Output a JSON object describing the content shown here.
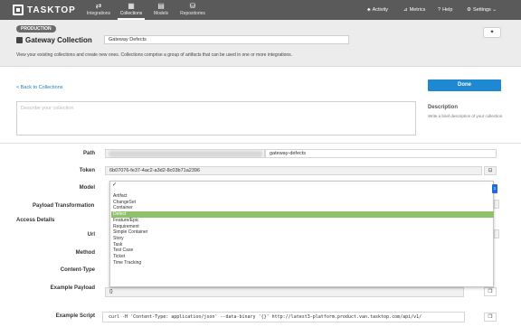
{
  "nav": {
    "logo": "TASKTOP",
    "items": [
      {
        "label": "Integrations",
        "icon": "⇄"
      },
      {
        "label": "Collections",
        "icon": "▦"
      },
      {
        "label": "Models",
        "icon": "▤"
      },
      {
        "label": "Repositories",
        "icon": "⛁"
      }
    ],
    "right": [
      {
        "label": "Activity",
        "icon": "♣"
      },
      {
        "label": "Metrics",
        "icon": "⊿"
      },
      {
        "label": "Help",
        "icon": "?"
      },
      {
        "label": "Settings ⌄",
        "icon": "⚙"
      }
    ]
  },
  "header": {
    "badge": "PRODUCTION",
    "title": "Gateway Collection",
    "name_value": "Gateway Defects",
    "description": "View your existing collections and create new ones. Collections comprise a group of artifacts that can be used in one or more integrations."
  },
  "actions": {
    "back": "< Back to Collections",
    "done": "Done"
  },
  "description_panel": {
    "placeholder": "Describe your collection",
    "side_title": "Description",
    "side_text": "Write a brief description of your collection."
  },
  "form": {
    "path_label": "Path",
    "path_suffix": "gateway-defects",
    "token_label": "Token",
    "token_value": "6b07076-fe37-4ac2-a3d2-8c03b71a2396",
    "model_label": "Model",
    "payload_transformation_label": "Payload Transformation",
    "access_details_label": "Access Details",
    "url_label": "Url",
    "method_label": "Method",
    "content_type_label": "Content-Type",
    "example_payload_label": "Example Payload",
    "example_payload_value": "{}",
    "example_script_label": "Example Script",
    "example_script_value": "curl -H 'Content-Type: application/json' --data-binary '{}' http://latest3-platform.product.van.tasktop.com/api/v1/"
  },
  "model_dropdown": {
    "check": "✓",
    "selected": "Defect",
    "options": [
      "Artifact",
      "ChangeSet",
      "Container",
      "Defect",
      "Feature/Epic",
      "Requirement",
      "Simple Container",
      "Story",
      "Task",
      "Test Case",
      "Ticket",
      "Time Tracking"
    ]
  }
}
